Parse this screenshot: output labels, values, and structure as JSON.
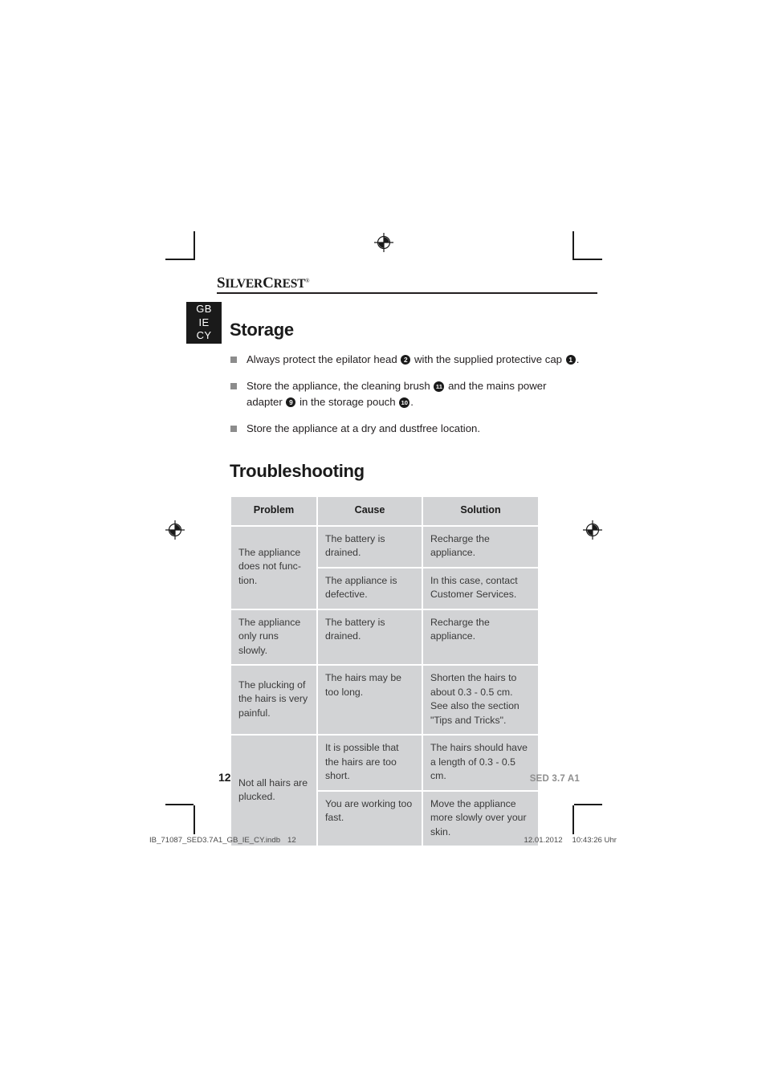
{
  "brand": {
    "logo_part1": "S",
    "logo_part2": "ILVER",
    "logo_part3": "C",
    "logo_part4": "REST",
    "trademark": "®"
  },
  "language_tab": {
    "line1": "GB",
    "line2": "IE",
    "line3": "CY"
  },
  "storage": {
    "title": "Storage",
    "bullets": [
      {
        "parts": [
          {
            "t": "text",
            "v": "Always protect the epilator head "
          },
          {
            "t": "num",
            "v": "2"
          },
          {
            "t": "text",
            "v": " with the supplied protective cap "
          },
          {
            "t": "num",
            "v": "1"
          },
          {
            "t": "text",
            "v": "."
          }
        ]
      },
      {
        "parts": [
          {
            "t": "text",
            "v": "Store the appliance, the cleaning brush "
          },
          {
            "t": "num",
            "v": "11"
          },
          {
            "t": "text",
            "v": " and the mains power adapter "
          },
          {
            "t": "num",
            "v": "9"
          },
          {
            "t": "text",
            "v": " in the storage pouch "
          },
          {
            "t": "num",
            "v": "10"
          },
          {
            "t": "text",
            "v": "."
          }
        ]
      },
      {
        "parts": [
          {
            "t": "text",
            "v": "Store the appliance at a dry and dustfree location."
          }
        ]
      }
    ]
  },
  "troubleshooting": {
    "title": "Troubleshooting",
    "columns": [
      "Problem",
      "Cause",
      "Solution"
    ],
    "rows": [
      {
        "problem": "The appliance does not func-tion.",
        "problem_rowspan": 2,
        "entries": [
          {
            "cause": "The battery is drained.",
            "solution": "Recharge the appliance."
          },
          {
            "cause": "The appliance is defective.",
            "solution": "In this case, contact Customer Services."
          }
        ]
      },
      {
        "problem": "The appliance only runs slowly.",
        "problem_rowspan": 1,
        "entries": [
          {
            "cause": "The battery is drained.",
            "solution": "Recharge the appliance."
          }
        ]
      },
      {
        "problem": "The plucking of the hairs is very painful.",
        "problem_rowspan": 1,
        "entries": [
          {
            "cause": "The hairs may be too long.",
            "solution": "Shorten the hairs to about 0.3 - 0.5 cm. See also the section \"Tips and Tricks\"."
          }
        ]
      },
      {
        "problem": "Not all hairs are plucked.",
        "problem_rowspan": 2,
        "entries": [
          {
            "cause": "It is possible that the hairs are too short.",
            "solution": "The hairs should have a length of 0.3 - 0.5 cm."
          },
          {
            "cause": "You are working too fast.",
            "solution": "Move the appliance more slowly over your skin."
          }
        ]
      }
    ]
  },
  "footer": {
    "page_number": "12",
    "model": "SED 3.7 A1"
  },
  "slug": {
    "filename": "IB_71087_SED3.7A1_GB_IE_CY.indb",
    "page": "12",
    "date": "12.01.2012",
    "time": "10:43:26 Uhr"
  }
}
